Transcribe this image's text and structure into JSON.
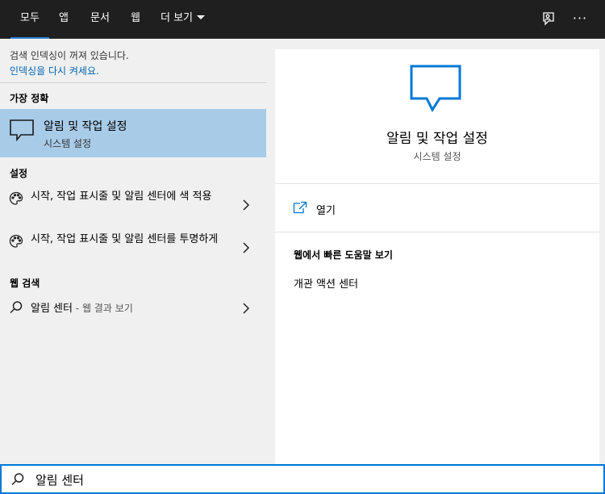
{
  "tabs": [
    {
      "label": "모두",
      "active": true
    },
    {
      "label": "앱"
    },
    {
      "label": "문서"
    },
    {
      "label": "웹"
    },
    {
      "label": "더 보기"
    }
  ],
  "top_icons": {
    "feedback": "feedback-icon",
    "more": "···"
  },
  "notice": {
    "text": "검색 인덱싱이 꺼져 있습니다.",
    "link": "인덱싱을 다시 켜세요."
  },
  "sections": {
    "best_match": "가장 정확",
    "settings": "설정",
    "web_search": "웹 검색"
  },
  "best_match": {
    "title": "알림 및 작업 설정",
    "subtitle": "시스템 설정",
    "icon": "notification-icon"
  },
  "settings_results": [
    {
      "label": "시작, 작업 표시줄 및 알림 센터에 색 적용",
      "icon": "palette-icon"
    },
    {
      "label": "시작, 작업 표시줄 및 알림 센터를 투명하게",
      "icon": "palette-icon"
    }
  ],
  "web_result": {
    "query": "알림 센터",
    "suffix": " - 웹 결과 보기",
    "icon": "search-icon"
  },
  "preview": {
    "title": "알림 및 작업 설정",
    "subtitle": "시스템 설정",
    "open_label": "열기",
    "web_help_title": "웹에서 빠른 도움말 보기",
    "web_help_link": "개관 액션 센터"
  },
  "search": {
    "value": "알림 센터"
  },
  "colors": {
    "accent": "#0078d7",
    "selected": "#a8cbe8",
    "topbar": "#1f1f1f",
    "link": "#0063b1"
  }
}
